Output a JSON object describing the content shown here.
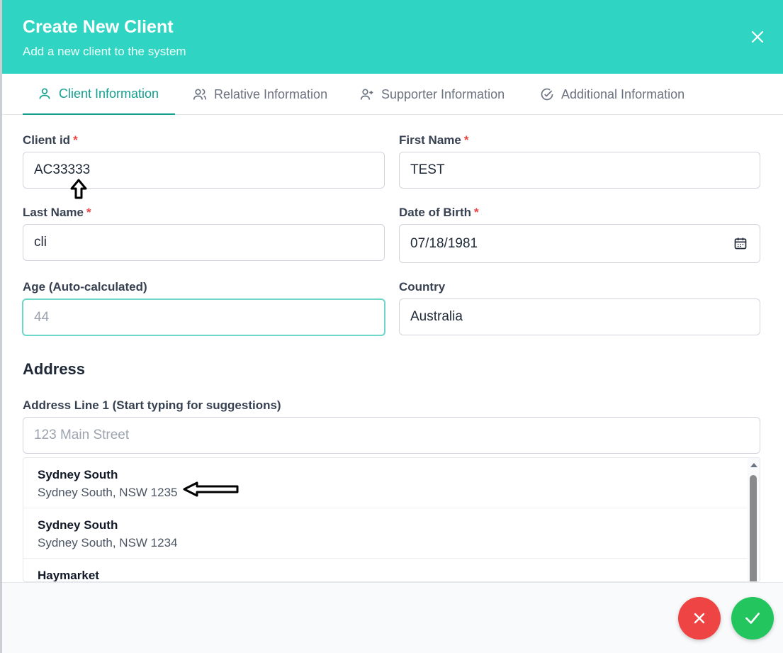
{
  "header": {
    "title": "Create New Client",
    "subtitle": "Add a new client to the system",
    "color": "#2fd5c2"
  },
  "tabs": [
    {
      "label": "Client Information",
      "icon": "user-icon",
      "active": true
    },
    {
      "label": "Relative Information",
      "icon": "users-icon",
      "active": false
    },
    {
      "label": "Supporter Information",
      "icon": "user-plus-icon",
      "active": false
    },
    {
      "label": "Additional Information",
      "icon": "check-circle-icon",
      "active": false
    }
  ],
  "form": {
    "client_id": {
      "label": "Client id",
      "required": "*",
      "value": "AC33333"
    },
    "first_name": {
      "label": "First Name",
      "required": "*",
      "value": "TEST"
    },
    "last_name": {
      "label": "Last Name",
      "required": "*",
      "value": "cli"
    },
    "dob": {
      "label": "Date of Birth",
      "required": "*",
      "value": "07/18/1981",
      "icon": "calendar-icon"
    },
    "age": {
      "label": "Age (Auto-calculated)",
      "value": "44"
    },
    "country": {
      "label": "Country",
      "value": "Australia"
    }
  },
  "address": {
    "section_title": "Address",
    "line1_label": "Address Line 1 (Start typing for suggestions)",
    "line1_placeholder": "123 Main Street",
    "suggestions": [
      {
        "name": "Sydney South",
        "detail": "Sydney South, NSW 1235"
      },
      {
        "name": "Sydney South",
        "detail": "Sydney South, NSW 1234"
      },
      {
        "name": "Haymarket",
        "detail": ""
      }
    ]
  },
  "footer": {
    "cancel_icon": "x-icon",
    "confirm_icon": "check-icon",
    "cancel_color": "#ef4444",
    "confirm_color": "#22c55e"
  }
}
